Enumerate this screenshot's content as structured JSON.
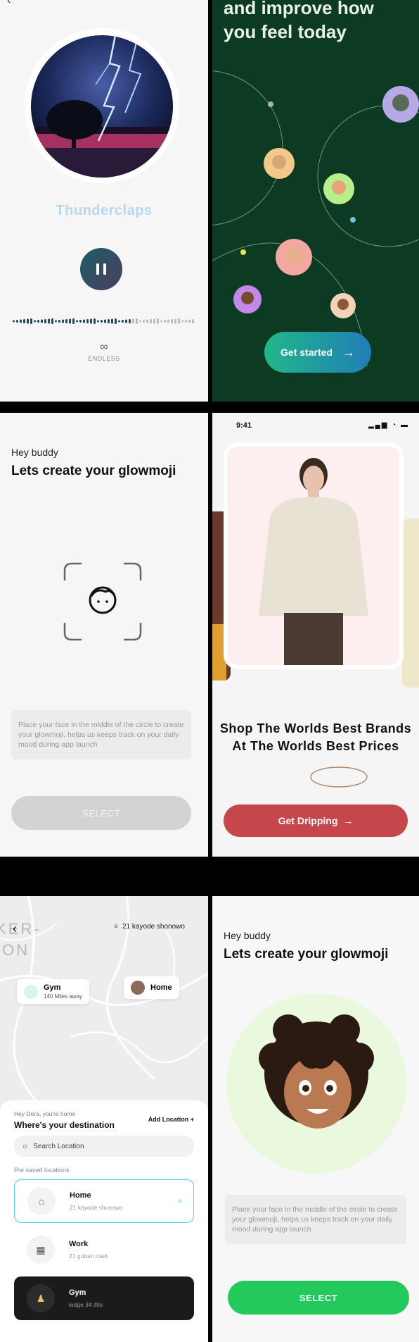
{
  "music": {
    "title": "Thunderclaps",
    "mode_label": "ENDLESS",
    "mode_icon": "infinity-icon"
  },
  "onboarding": {
    "headline": "and improve how you feel today",
    "cta_label": "Get started"
  },
  "glowmoji_empty": {
    "greeting": "Hey buddy",
    "heading": "Lets create your glowmoji",
    "instruction": "Place your face in the middle of the circle to create your glowmoji, helps us keeps track on your daily mood during app launch",
    "select_label": "SELECT"
  },
  "shop": {
    "status_time": "9:41",
    "headline": "Shop The Worlds Best Brands At The Worlds Best Prices",
    "cta_label": "Get Dripping"
  },
  "map": {
    "back_icon": "chevron-left-icon",
    "map_label_line1": "KER-",
    "map_label_line2": "ION",
    "current_location": "21 kayode shonowo",
    "pins": [
      {
        "name": "Gym",
        "detail": "140 Miles away"
      },
      {
        "name": "Home"
      }
    ],
    "greeting": "Hey Dera, you're home",
    "question": "Where's your destination",
    "add_location_label": "Add Location",
    "search_placeholder": "Search Location",
    "saved_header": "Pre saved locations",
    "locations": [
      {
        "name": "Home",
        "address": "21 kayode shonowo"
      },
      {
        "name": "Work",
        "address": "21 goban road"
      },
      {
        "name": "Gym",
        "address": "lodge 34 ifite"
      }
    ]
  },
  "glowmoji_face": {
    "greeting": "Hey buddy",
    "heading": "Lets create your glowmoji",
    "instruction": "Place your face in the middle of the circle to create your glowmoji, helps us keeps track on your daily mood during app launch",
    "select_label": "SELECT"
  },
  "colors": {
    "green_accent": "#23c95a",
    "shop_red": "#c5474b",
    "onboarding_bg": "#0d3a22",
    "teal_border": "#4fd8e6"
  }
}
